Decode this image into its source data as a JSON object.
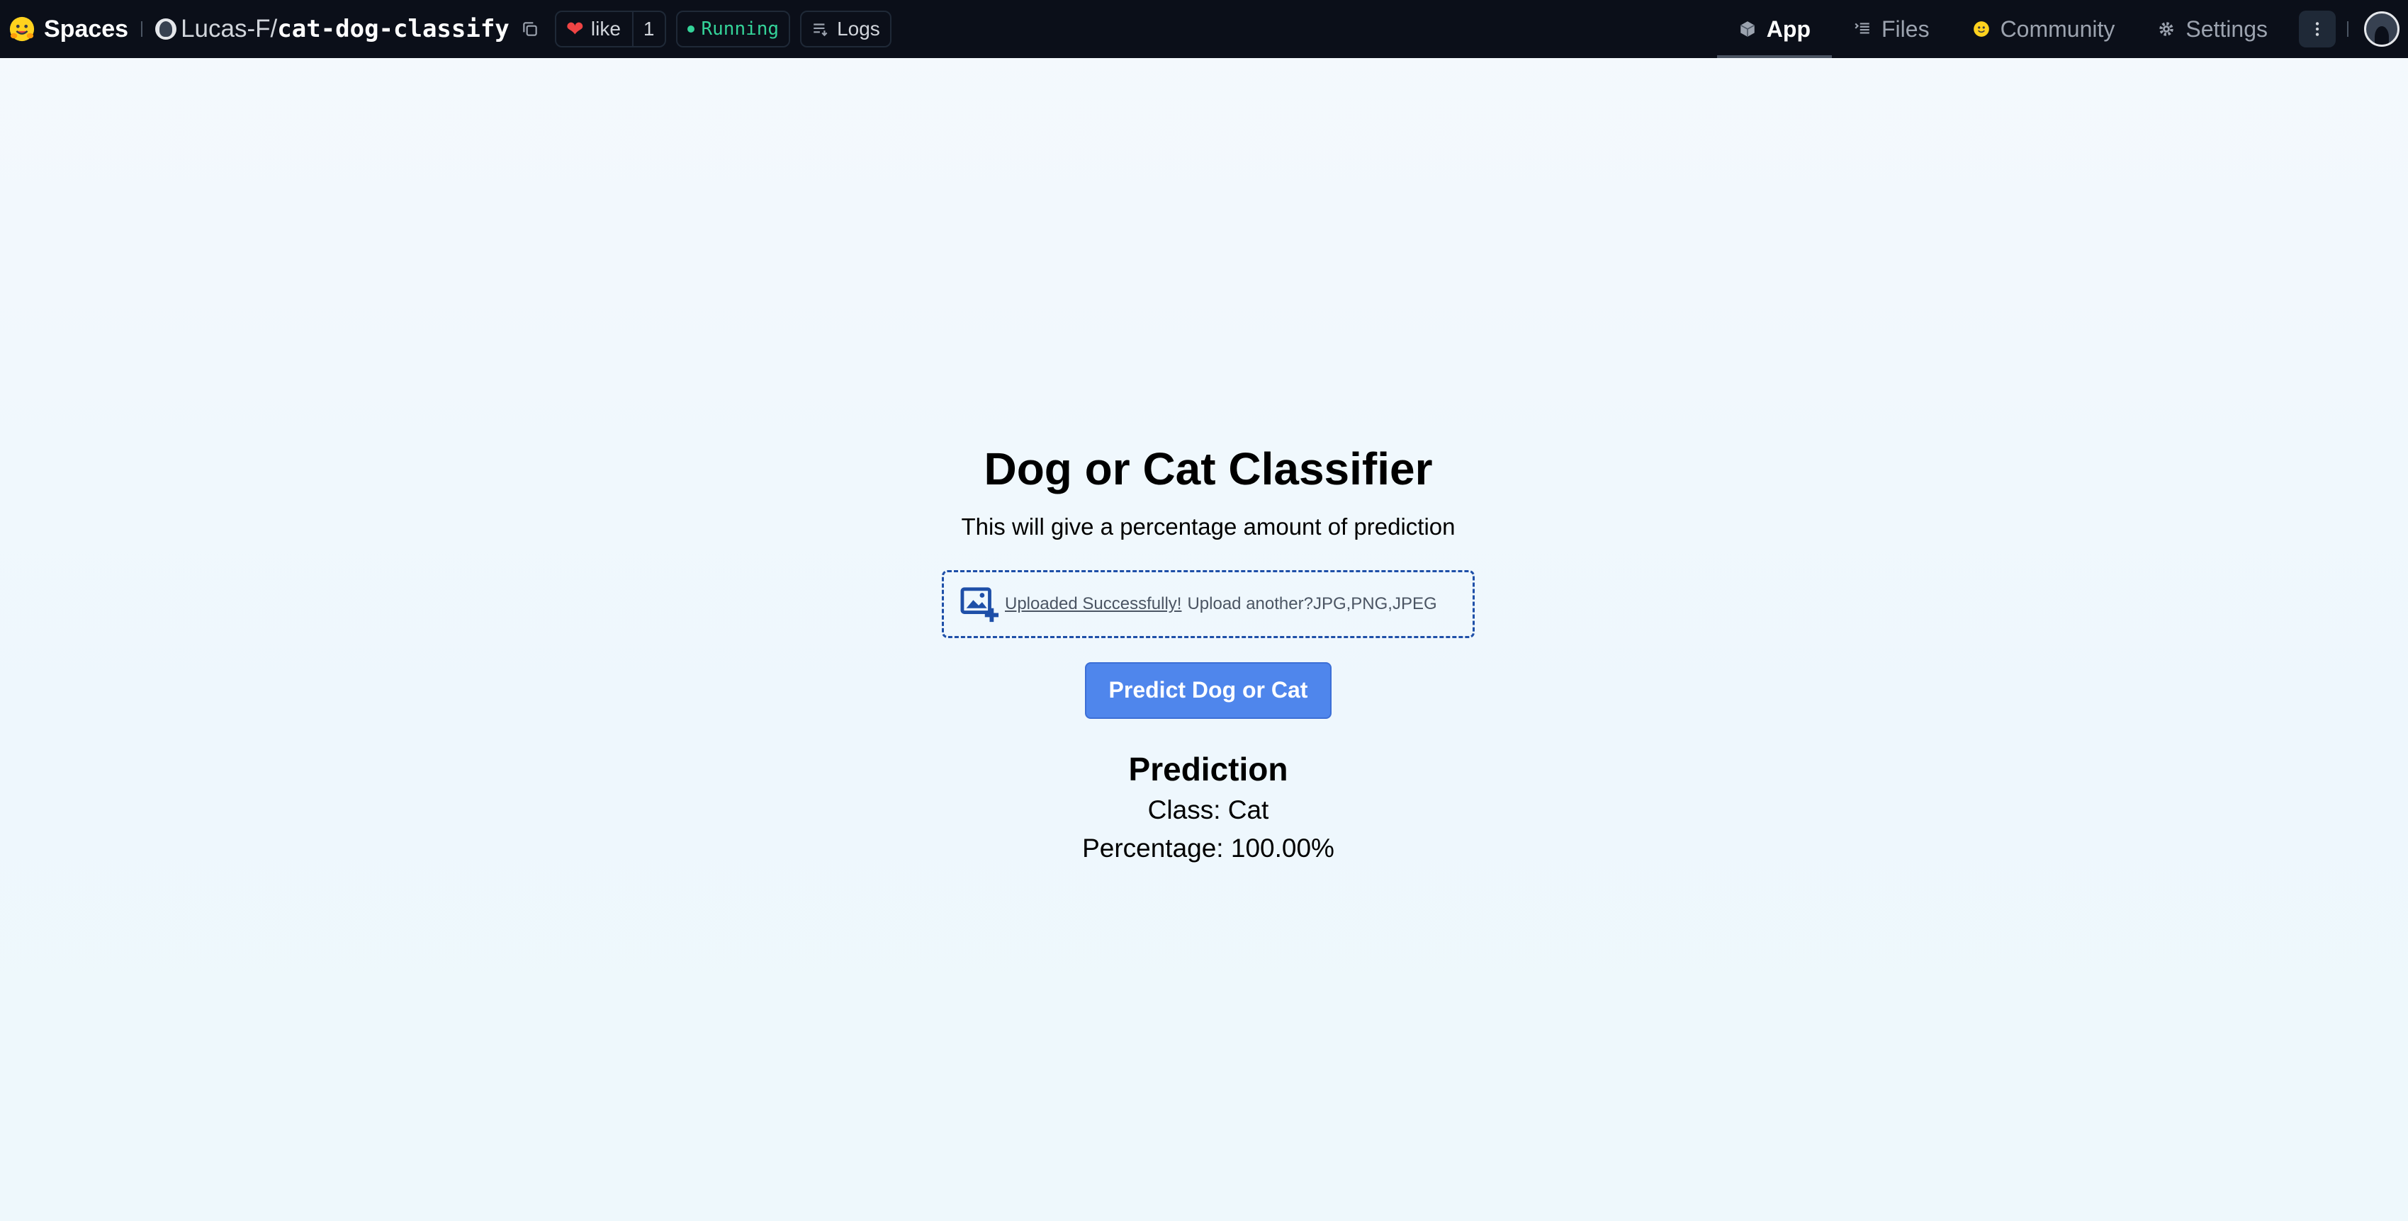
{
  "header": {
    "spaces_label": "Spaces",
    "owner": "Lucas-F/",
    "repo": "cat-dog-classify",
    "like_label": "like",
    "like_count": "1",
    "status": "Running",
    "logs_label": "Logs",
    "tabs": [
      {
        "label": "App",
        "icon": "cube-icon",
        "active": true
      },
      {
        "label": "Files",
        "icon": "files-icon",
        "active": false
      },
      {
        "label": "Community",
        "icon": "community-icon",
        "active": false
      },
      {
        "label": "Settings",
        "icon": "gear-icon",
        "active": false
      }
    ]
  },
  "app": {
    "title": "Dog or Cat Classifier",
    "description": "This will give a percentage amount of prediction",
    "upload": {
      "success_text": "Uploaded Successfully!",
      "another_text": "Upload another?",
      "types_text": "JPG,PNG,JPEG"
    },
    "predict_button": "Predict Dog or Cat",
    "prediction": {
      "heading": "Prediction",
      "class_text": "Class: Cat",
      "percentage_text": "Percentage: 100.00%"
    }
  },
  "colors": {
    "topbar_bg": "#0b0f19",
    "accent_blue": "#4f86ec",
    "upload_border": "#1e4fa8",
    "status_green": "#34d399",
    "heart_red": "#ef4444"
  }
}
